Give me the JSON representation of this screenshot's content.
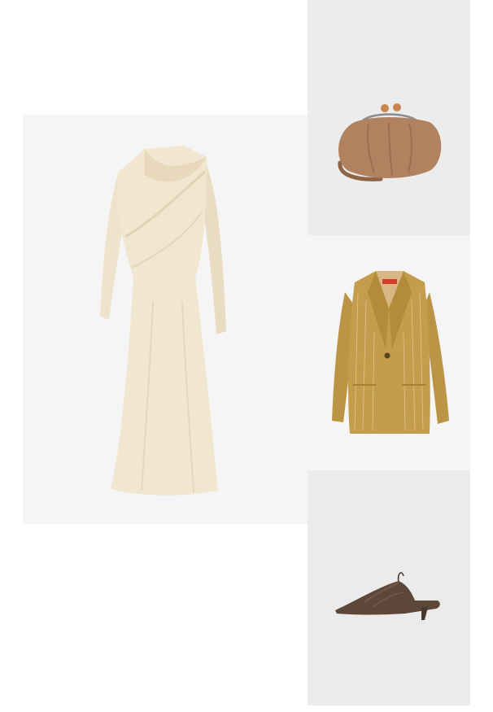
{
  "products": [
    {
      "item": "dress",
      "bg": "#f5f5f5",
      "color": "#f1e6d0"
    },
    {
      "item": "bag",
      "bg": "#ececec",
      "color": "#b0825f"
    },
    {
      "item": "blazer",
      "bg": "#f5f5f5",
      "color": "#c39d4b"
    },
    {
      "item": "shoe",
      "bg": "#ebebeb",
      "color": "#5c4739"
    }
  ]
}
